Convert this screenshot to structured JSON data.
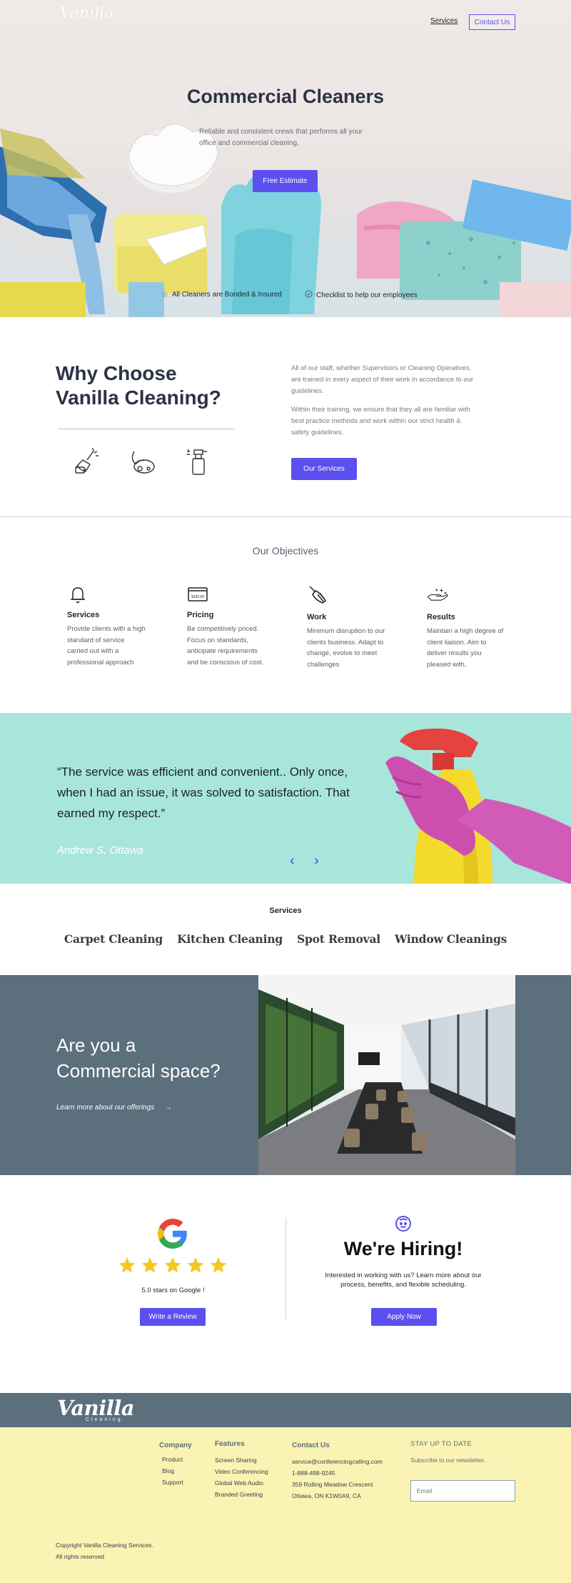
{
  "header": {
    "logo": "Vanilla",
    "nav_services": "Services",
    "nav_contact": "Contact Us"
  },
  "hero": {
    "title": "Commercial Cleaners",
    "subtitle": "Reliable and consistent crews that performs all your office and commercial cleaning.",
    "cta": "Free Estimate",
    "features": [
      {
        "icon": "star-outline-icon",
        "label": "All Cleaners are Bonded & Insured"
      },
      {
        "icon": "check-circle-icon",
        "label": "Checklist to help our employees"
      }
    ]
  },
  "why": {
    "title_line1": "Why Choose",
    "title_line2": "Vanilla Cleaning?",
    "paragraph1": "All of our staff, whether Supervisors or Cleaning Operatives, are trained in every aspect of their work in accordance to our guidelines.",
    "paragraph2": "Within their training, we ensure that they all are familiar with best practice methods and work within our strict health & safety guidelines.",
    "cta": "Our Services",
    "icons": [
      "broom-dustpan-icon",
      "vacuum-icon",
      "spray-bottle-icon"
    ]
  },
  "objectives": {
    "heading": "Our Objectives",
    "items": [
      {
        "icon": "bell-icon",
        "title": "Services",
        "desc": "Provide clients with a high standard of service carried out with a professional approach"
      },
      {
        "icon": "money-bill-icon",
        "title": "Pricing",
        "desc": "Be competitively priced. Focus on standards, anticipate requirements and be conscious of cost."
      },
      {
        "icon": "duster-icon",
        "title": "Work",
        "desc": "Minimum disruption to our clients business. Adapt to change, evolve to meet challenges"
      },
      {
        "icon": "sparkling-hand-icon",
        "title": "Results",
        "desc": "Maintain a high degree of client liaison. Aim to deliver results you pleased with."
      }
    ],
    "pricing_icon_text": "$100.00"
  },
  "testimonial": {
    "quote": "“The service was efficient and convenient.. Only once, when I had an issue, it was solved to satisfaction. That earned my respect.”",
    "author": "Andrew S, Ottawa",
    "prev": "‹",
    "next": "›"
  },
  "services": {
    "label": "Services",
    "items": [
      "Carpet Cleaning",
      "Kitchen Cleaning",
      "Spot Removal",
      "Window Cleanings"
    ]
  },
  "commercial": {
    "line1": "Are you a",
    "line2": "Commercial space?",
    "link": "Learn more about our offerings",
    "link_arrow": "→"
  },
  "reviews": {
    "stars": 5,
    "rating_text": "5.0 stars on Google !",
    "cta": "Write a Review"
  },
  "hiring": {
    "title": "We're Hiring!",
    "text": "Interested in working with us? Learn more about our process, benefits, and flexible scheduling.",
    "cta": "Apply Now"
  },
  "footer": {
    "logo": "Vanilla",
    "logo_sub": "Cleaning",
    "company": {
      "heading": "Company",
      "items": [
        "Product",
        "Blog",
        "Support"
      ]
    },
    "features": {
      "heading": "Features",
      "items": [
        "Screen Sharing",
        "Video Conferencing",
        "Global Web Audio",
        "Branded Greeting"
      ]
    },
    "contact": {
      "heading": "Contact Us",
      "items": [
        "service@conferencingcalling.com",
        "1-888-498-9245",
        "359 Rolling Meadow Crescent",
        "Ottawa, ON K1W0A9, CA"
      ]
    },
    "newsletter": {
      "heading": "STAY UP TO DATE",
      "text": "Subscribe to our newsletter.",
      "placeholder": "Email",
      "arrow": "→"
    },
    "copyright1": "Copyright Vanilla Cleaning Services.",
    "copyright2": "All rights reserved"
  },
  "colors": {
    "accent": "#5b4ff0",
    "slate": "#5b6f7d",
    "mint": "#a8e6dc",
    "footer_bg": "#faf3b3",
    "star": "#f4c820"
  }
}
